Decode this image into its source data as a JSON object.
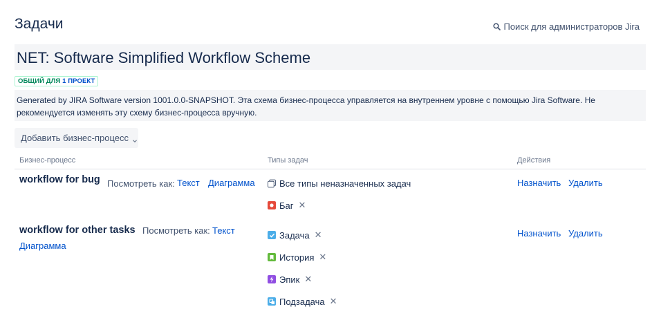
{
  "header": {
    "title": "Задачи",
    "admin_search_label": "Поиск для администраторов Jira"
  },
  "scheme": {
    "title": "NET: Software Simplified Workflow Scheme",
    "shared_prefix": "ОБЩИЙ ДЛЯ ",
    "shared_link": "1 ПРОЕКТ",
    "description": "Generated by JIRA Software version 1001.0.0-SNAPSHOT. Эта схема бизнес-процесса управляется на внутреннем уровне с помощью Jira Software. Не рекомендуется изменять эту схему бизнес-процесса вручную."
  },
  "toolbar": {
    "add_workflow_label": "Добавить бизнес-процесс"
  },
  "table": {
    "headers": {
      "workflow": "Бизнес-процесс",
      "issue_types": "Типы задач",
      "actions": "Действия"
    },
    "view_as_label": "Посмотреть как:",
    "text_link": "Текст",
    "diagram_link": "Диаграмма",
    "assign_label": "Назначить",
    "delete_label": "Удалить",
    "rows": [
      {
        "name": "workflow for bug",
        "issue_types": [
          {
            "label": "Все типы неназначенных задач",
            "icon": "unassigned-types-icon",
            "color": "#ffffff",
            "removable": false
          },
          {
            "label": "Баг",
            "icon": "bug-icon",
            "color": "#e5493a",
            "removable": true
          }
        ]
      },
      {
        "name": "workflow for other tasks",
        "issue_types": [
          {
            "label": "Задача",
            "icon": "task-icon",
            "color": "#4bade8",
            "removable": true
          },
          {
            "label": "История",
            "icon": "story-icon",
            "color": "#63ba3c",
            "removable": true
          },
          {
            "label": "Эпик",
            "icon": "epic-icon",
            "color": "#904ee2",
            "removable": true
          },
          {
            "label": "Подзадача",
            "icon": "subtask-icon",
            "color": "#4bade8",
            "removable": true
          }
        ]
      }
    ]
  }
}
